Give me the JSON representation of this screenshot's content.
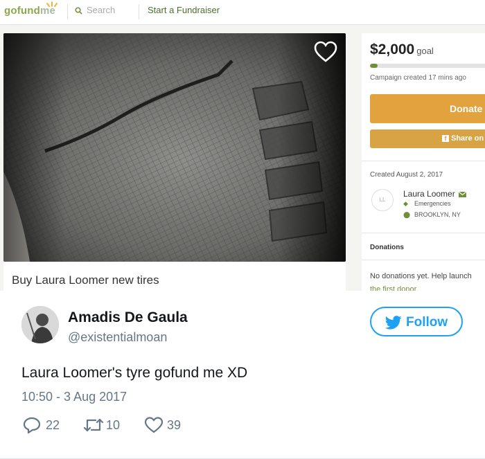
{
  "gofundme": {
    "logo": {
      "part1": "gofund",
      "part2": "me"
    },
    "search_placeholder": "Search",
    "nav_start": "Start a Fundraiser",
    "campaign_title": "Buy Laura Loomer new tires",
    "goal_amount": "$2,000",
    "goal_label": "goal",
    "progress_fraction": 0.06,
    "created_ago": "Campaign created 17 mins ago",
    "donate_label": "Donate",
    "share_label": "Share on",
    "created_date": "Created August 2, 2017",
    "organizer": {
      "initials": "LL",
      "name": "Laura Loomer",
      "category": "Emergencies",
      "location": "BROOKLYN, NY"
    },
    "donations_heading": "Donations",
    "donations_empty_line1": "No donations yet. Help launch",
    "donations_empty_line2": "the first donor."
  },
  "tweet": {
    "name": "Amadis De Gaula",
    "handle": "@existentialmoan",
    "follow_label": "Follow",
    "text": "Laura Loomer's tyre gofund me XD",
    "timestamp": "10:50 - 3 Aug 2017",
    "replies": "22",
    "retweets": "10",
    "likes": "39"
  },
  "colors": {
    "gofundme_green": "#6f8f38",
    "donate_orange": "#e2a33e",
    "twitter_blue": "#1da1f2"
  }
}
